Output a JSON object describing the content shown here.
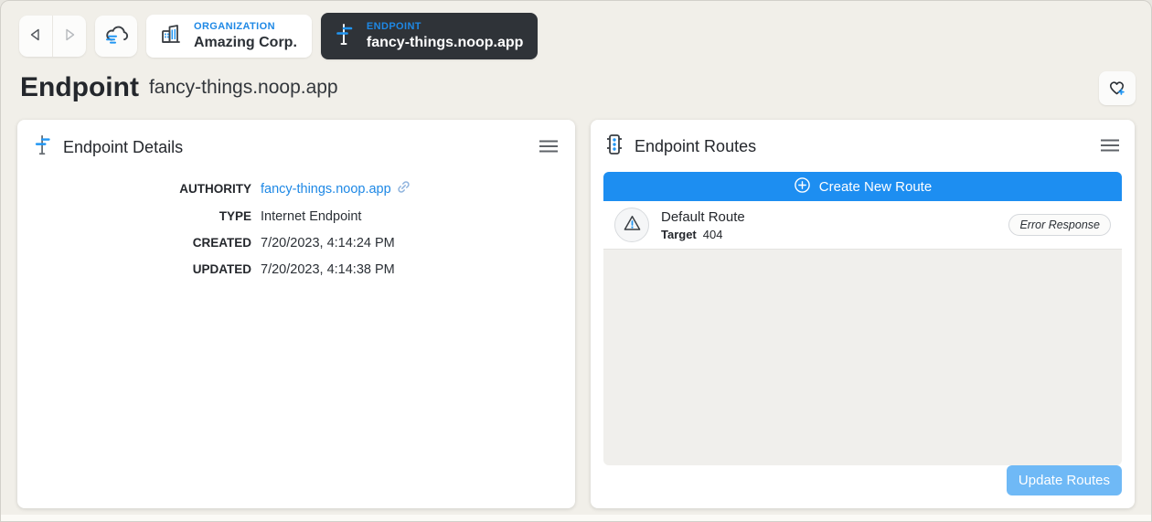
{
  "nav": {
    "organization": {
      "kicker": "ORGANIZATION",
      "label": "Amazing Corp."
    },
    "endpoint": {
      "kicker": "ENDPOINT",
      "label": "fancy-things.noop.app"
    }
  },
  "header": {
    "title": "Endpoint",
    "subtitle": "fancy-things.noop.app"
  },
  "details_card": {
    "title": "Endpoint Details",
    "fields": [
      {
        "label": "AUTHORITY",
        "value": "fancy-things.noop.app"
      },
      {
        "label": "TYPE",
        "value": "Internet Endpoint"
      },
      {
        "label": "CREATED",
        "value": "7/20/2023, 4:14:24 PM"
      },
      {
        "label": "UPDATED",
        "value": "7/20/2023, 4:14:38 PM"
      }
    ]
  },
  "routes_card": {
    "title": "Endpoint Routes",
    "create_label": "Create New Route",
    "routes": [
      {
        "name": "Default Route",
        "target_label": "Target",
        "target_value": "404",
        "badge": "Error Response"
      }
    ],
    "update_label": "Update Routes"
  },
  "icons": {
    "back": "back-arrow-icon",
    "forward": "forward-arrow-icon",
    "cloud": "noop-cloud-icon",
    "organization": "building-icon",
    "endpoint": "signpost-icon",
    "favorite": "heart-plus-icon",
    "routes": "traffic-light-icon",
    "menu": "hamburger-menu-icon",
    "create": "circle-plus-icon",
    "warning": "warning-triangle-icon",
    "link": "chain-link-icon"
  },
  "colors": {
    "accent_blue": "#1e88e5",
    "create_button": "#1d8ef1",
    "update_button_disabled": "#6fb9f6",
    "dark_chip": "#2f3338",
    "page_background": "#f1efe9",
    "card_background": "#ffffff",
    "list_background": "#f0efec"
  }
}
